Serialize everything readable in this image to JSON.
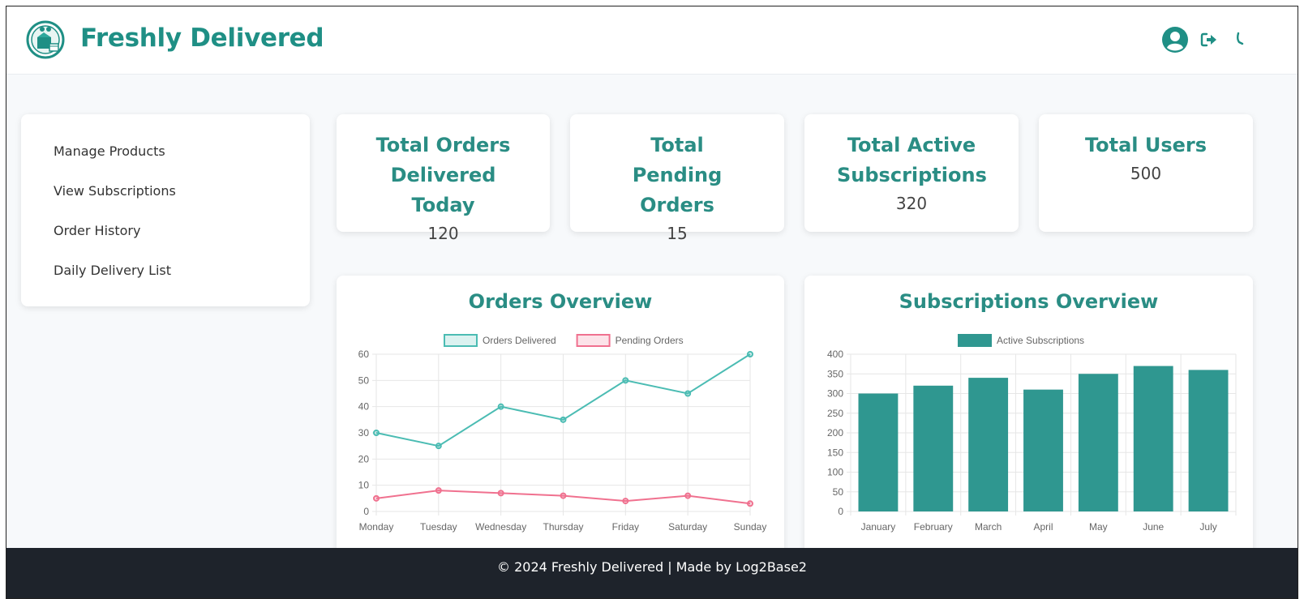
{
  "header": {
    "brand": "Freshly Delivered",
    "logo_icon": "delivery-box-logo-icon",
    "accent_color": "#1f8f85"
  },
  "sidebar": {
    "items": [
      {
        "label": "Manage Products"
      },
      {
        "label": "View Subscriptions"
      },
      {
        "label": "Order History"
      },
      {
        "label": "Daily Delivery List"
      }
    ]
  },
  "stats": [
    {
      "title": "Total Orders Delivered Today",
      "value": "120"
    },
    {
      "title": "Total Pending Orders",
      "value": "15"
    },
    {
      "title": "Total Active Subscriptions",
      "value": "320"
    },
    {
      "title": "Total Users",
      "value": "500"
    }
  ],
  "charts": {
    "orders_title": "Orders Overview",
    "subs_title": "Subscriptions Overview"
  },
  "chart_data": [
    {
      "type": "line",
      "title": "Orders Overview",
      "categories": [
        "Monday",
        "Tuesday",
        "Wednesday",
        "Thursday",
        "Friday",
        "Saturday",
        "Sunday"
      ],
      "series": [
        {
          "name": "Orders Delivered",
          "values": [
            30,
            25,
            40,
            35,
            50,
            45,
            60
          ],
          "color": "#4bbcb3"
        },
        {
          "name": "Pending Orders",
          "values": [
            5,
            8,
            7,
            6,
            4,
            6,
            3
          ],
          "color": "#f0718f"
        }
      ],
      "ylim": [
        0,
        60
      ],
      "yticks": [
        0,
        10,
        20,
        30,
        40,
        50,
        60
      ],
      "grid": true,
      "legend": "top"
    },
    {
      "type": "bar",
      "title": "Subscriptions Overview",
      "categories": [
        "January",
        "February",
        "March",
        "April",
        "May",
        "June",
        "July"
      ],
      "series": [
        {
          "name": "Active Subscriptions",
          "values": [
            300,
            320,
            340,
            310,
            350,
            370,
            360
          ],
          "color": "#2f9790"
        }
      ],
      "ylim": [
        0,
        400
      ],
      "yticks": [
        0,
        50,
        100,
        150,
        200,
        250,
        300,
        350,
        400
      ],
      "grid": true,
      "legend": "top"
    }
  ],
  "footer": {
    "text": "© 2024 Freshly Delivered | Made by Log2Base2"
  }
}
